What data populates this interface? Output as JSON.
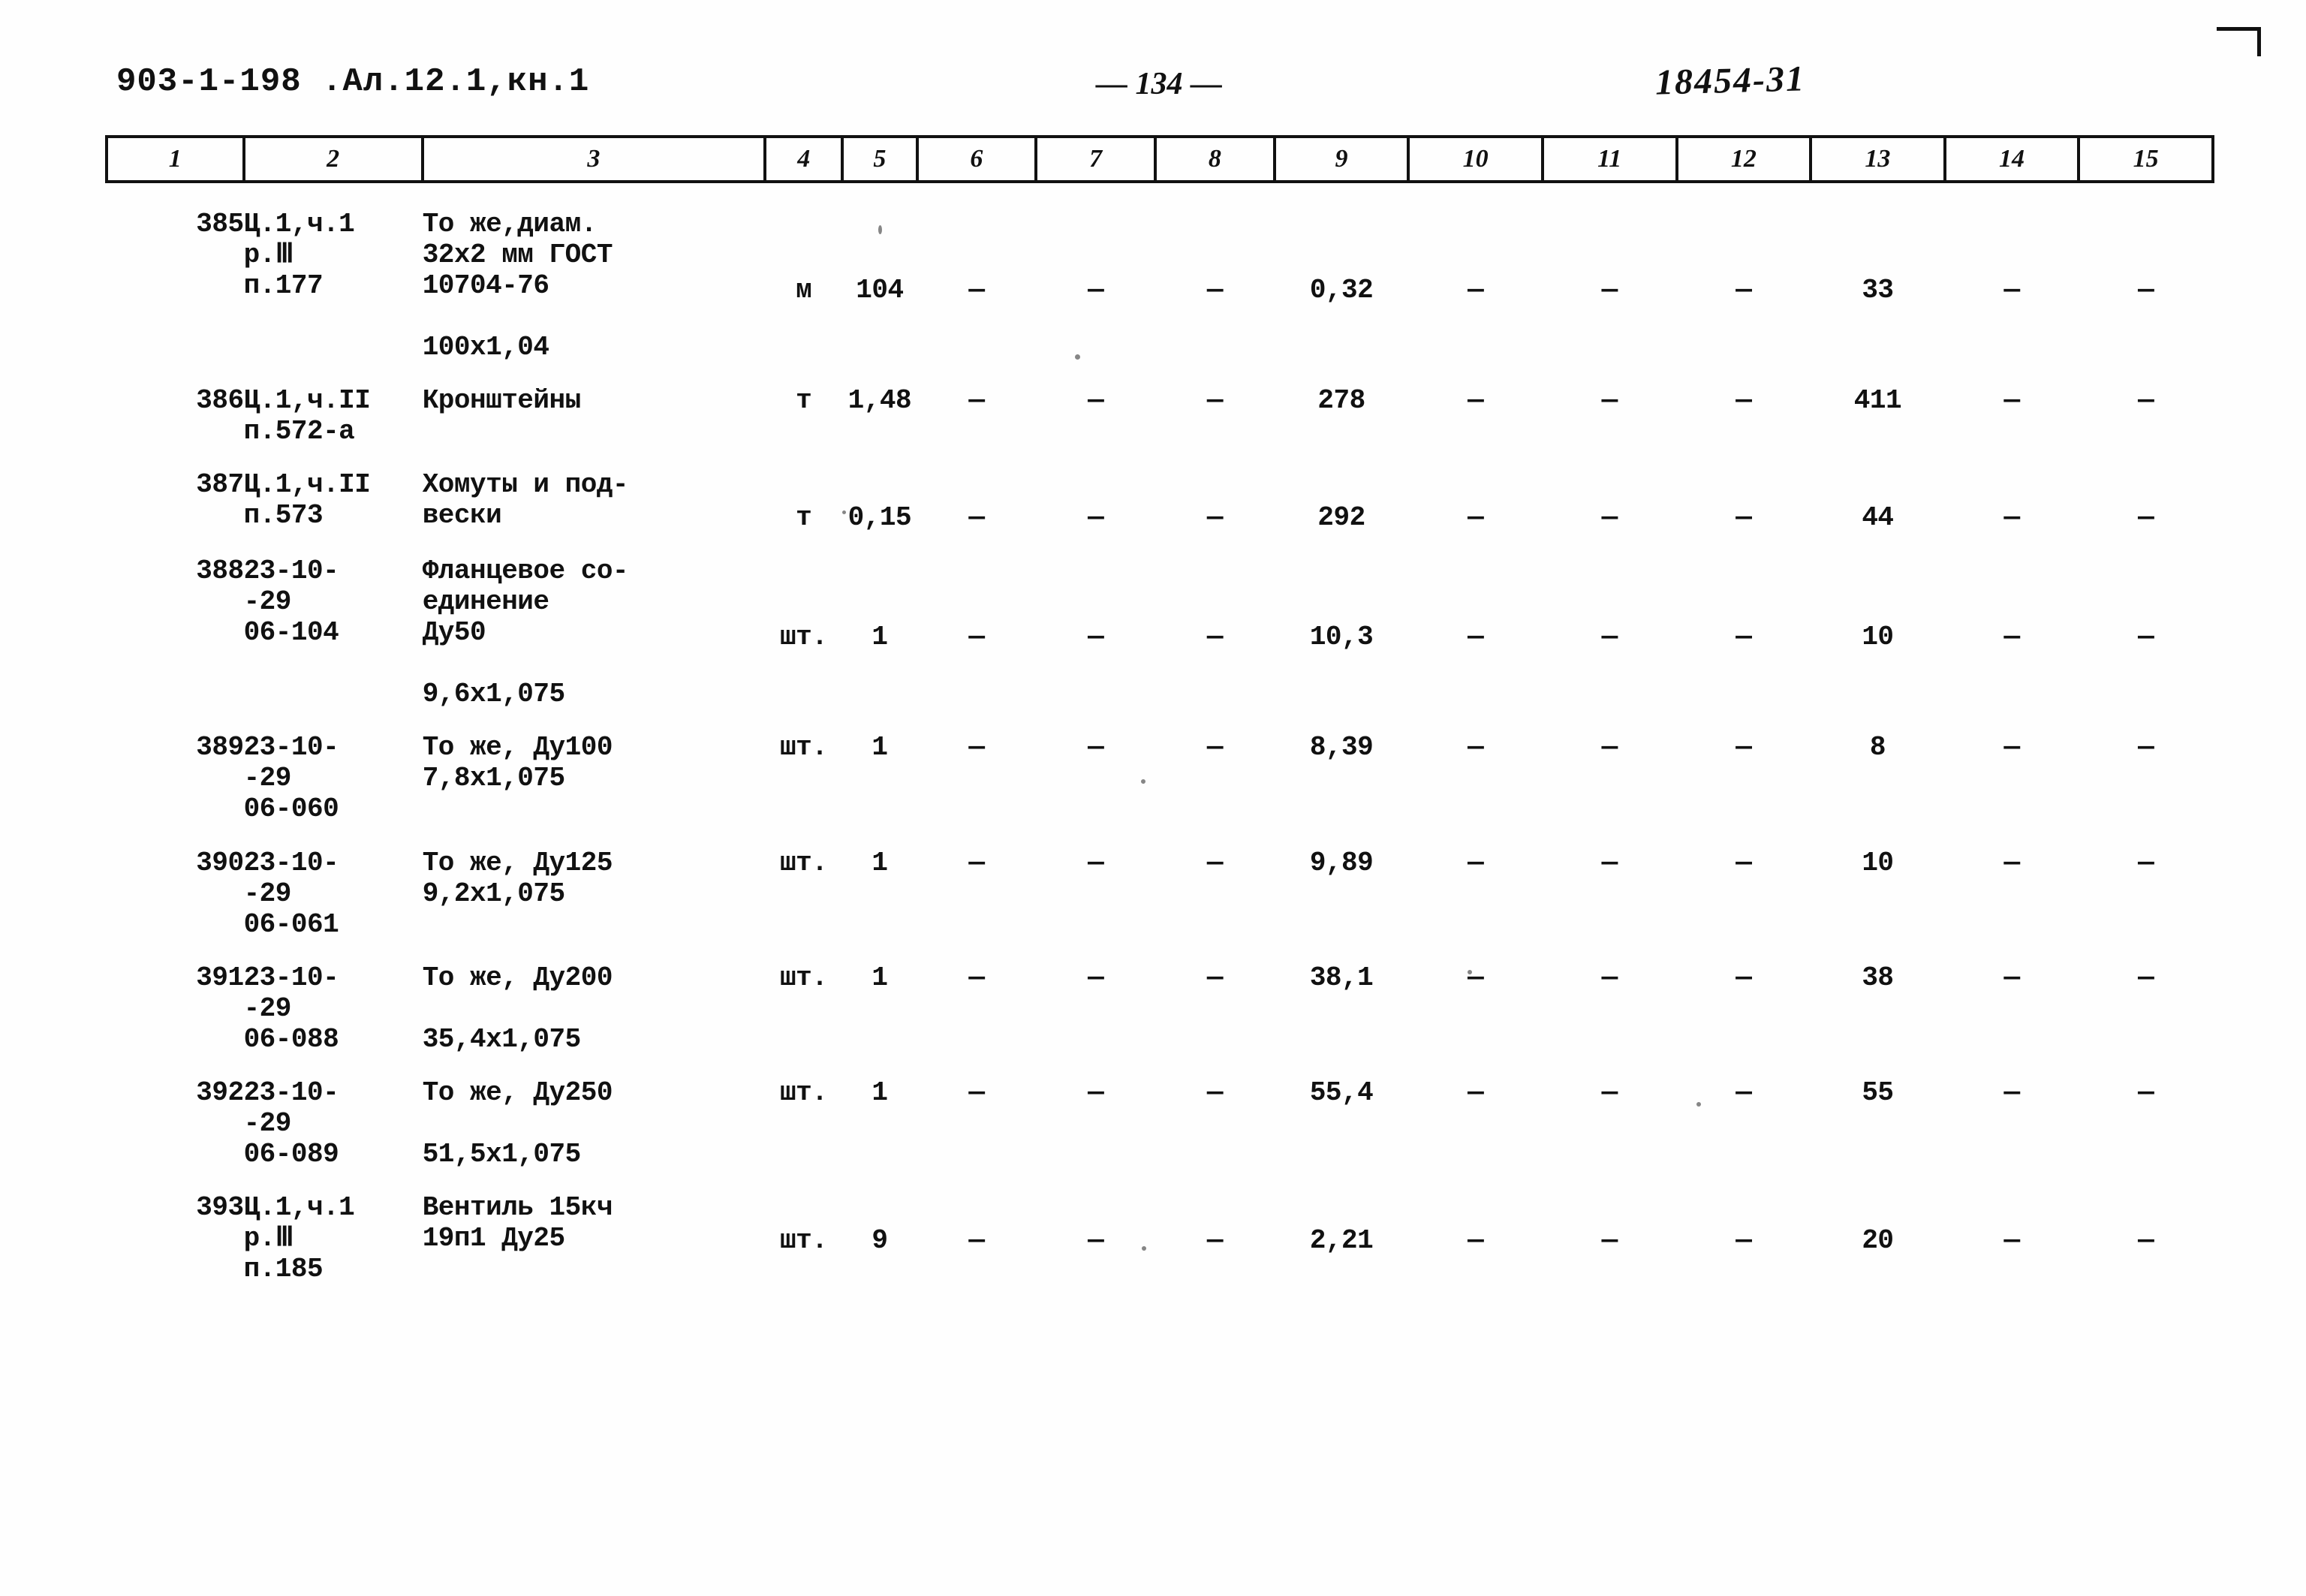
{
  "header": {
    "doc_code": "903-1-198  .Ал.12.1,кн.1",
    "page_number": "— 134 —",
    "hand_code": "18454-31"
  },
  "table": {
    "column_headers": [
      "1",
      "2",
      "3",
      "4",
      "5",
      "6",
      "7",
      "8",
      "9",
      "10",
      "11",
      "12",
      "13",
      "14",
      "15"
    ],
    "dash": "—",
    "rows": [
      {
        "no": "385",
        "code": "Ц.1,ч.1\nр.Ⅲ\nп.177",
        "name": "То же,диам.\n32х2 мм ГОСТ\n10704-76\n\n100х1,04",
        "unit": "м",
        "qty": "104",
        "c6": "—",
        "c7": "—",
        "c8": "—",
        "c9": "0,32",
        "c10": "—",
        "c11": "—",
        "c12": "—",
        "c13": "33",
        "c14": "—",
        "c15": "—",
        "val_offset": 2
      },
      {
        "no": "386",
        "code": "Ц.1,ч.II\nп.572-а",
        "name": "Кронштейны",
        "unit": "т",
        "qty": "1,48",
        "c6": "—",
        "c7": "—",
        "c8": "—",
        "c9": "278",
        "c10": "—",
        "c11": "—",
        "c12": "—",
        "c13": "411",
        "c14": "—",
        "c15": "—",
        "val_offset": 0
      },
      {
        "no": "387",
        "code": "Ц.1,ч.II\nп.573",
        "name": "Хомуты и под-\nвески",
        "unit": "т",
        "qty": "0,15",
        "c6": "—",
        "c7": "—",
        "c8": "—",
        "c9": "292",
        "c10": "—",
        "c11": "—",
        "c12": "—",
        "c13": "44",
        "c14": "—",
        "c15": "—",
        "val_offset": 1
      },
      {
        "no": "388",
        "code": "23-10-\n-29\n06-104",
        "name": "Фланцевое со-\nединение\nДу50\n\n9,6х1,075",
        "unit": "шт.",
        "qty": "1",
        "c6": "—",
        "c7": "—",
        "c8": "—",
        "c9": "10,3",
        "c10": "—",
        "c11": "—",
        "c12": "—",
        "c13": "10",
        "c14": "—",
        "c15": "—",
        "val_offset": 2
      },
      {
        "no": "389",
        "code": "23-10-\n-29\n06-060",
        "name": "То же, Ду100\n7,8х1,075",
        "unit": "шт.",
        "qty": "1",
        "c6": "—",
        "c7": "—",
        "c8": "—",
        "c9": "8,39",
        "c10": "—",
        "c11": "—",
        "c12": "—",
        "c13": "8",
        "c14": "—",
        "c15": "—",
        "val_offset": 0
      },
      {
        "no": "390",
        "code": "23-10-\n-29\n06-061",
        "name": "То же, Ду125\n9,2х1,075",
        "unit": "шт.",
        "qty": "1",
        "c6": "—",
        "c7": "—",
        "c8": "—",
        "c9": "9,89",
        "c10": "—",
        "c11": "—",
        "c12": "—",
        "c13": "10",
        "c14": "—",
        "c15": "—",
        "val_offset": 0
      },
      {
        "no": "391",
        "code": "23-10-\n-29\n06-088",
        "name": "То же, Ду200\n\n35,4х1,075",
        "unit": "шт.",
        "qty": "1",
        "c6": "—",
        "c7": "—",
        "c8": "—",
        "c9": "38,1",
        "c10": "—",
        "c11": "—",
        "c12": "—",
        "c13": "38",
        "c14": "—",
        "c15": "—",
        "val_offset": 0
      },
      {
        "no": "392",
        "code": "23-10-\n-29\n06-089",
        "name": "То же, Ду250\n\n51,5х1,075",
        "unit": "шт.",
        "qty": "1",
        "c6": "—",
        "c7": "—",
        "c8": "—",
        "c9": "55,4",
        "c10": "—",
        "c11": "—",
        "c12": "—",
        "c13": "55",
        "c14": "—",
        "c15": "—",
        "val_offset": 0
      },
      {
        "no": "393",
        "code": "Ц.1,ч.1\nр.Ⅲ\nп.185",
        "name": "Вентиль 15кч\n19п1 Ду25",
        "unit": "шт.",
        "qty": "9",
        "c6": "—",
        "c7": "—",
        "c8": "—",
        "c9": "2,21",
        "c10": "—",
        "c11": "—",
        "c12": "—",
        "c13": "20",
        "c14": "—",
        "c15": "—",
        "val_offset": 1
      }
    ]
  }
}
